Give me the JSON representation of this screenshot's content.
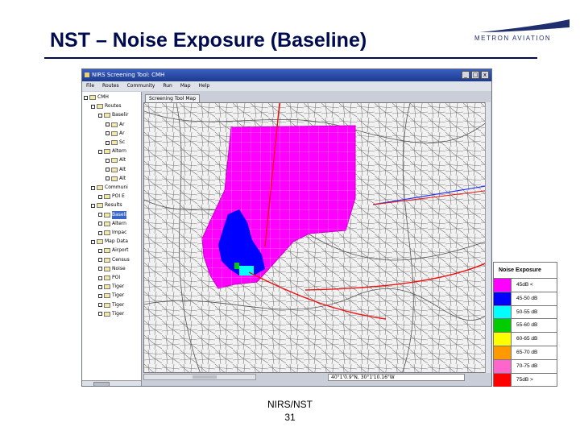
{
  "slide": {
    "title": "NST – Noise Exposure (Baseline)",
    "footer_line1": "NIRS/NST",
    "footer_line2": "31"
  },
  "logo": {
    "text": "METRON AVIATION",
    "icon": "metron-wing-logo"
  },
  "app": {
    "window_title": "NIRS Screening Tool: CMH",
    "menu": [
      "File",
      "Routes",
      "Community",
      "Run",
      "Map",
      "Help"
    ],
    "window_buttons": [
      "_",
      "□",
      "x"
    ],
    "tab_label": "Screening Tool Map",
    "coordinates": "40°1'0.9\"N, 30°1'10.16\"W"
  },
  "tree": {
    "items": [
      {
        "label": "CMH",
        "level": 0,
        "selected": false
      },
      {
        "label": "Routes",
        "level": 1,
        "selected": false
      },
      {
        "label": "Baselir",
        "level": 2,
        "selected": false
      },
      {
        "label": "Ar",
        "level": 3,
        "selected": false
      },
      {
        "label": "Ar",
        "level": 3,
        "selected": false
      },
      {
        "label": "Sc",
        "level": 3,
        "selected": false
      },
      {
        "label": "Altern",
        "level": 2,
        "selected": false
      },
      {
        "label": "Alt",
        "level": 3,
        "selected": false
      },
      {
        "label": "Alt",
        "level": 3,
        "selected": false
      },
      {
        "label": "Alt",
        "level": 3,
        "selected": false
      },
      {
        "label": "Communi",
        "level": 1,
        "selected": false
      },
      {
        "label": "POI E",
        "level": 2,
        "selected": false
      },
      {
        "label": "Results",
        "level": 1,
        "selected": false
      },
      {
        "label": "Baseli",
        "level": 2,
        "selected": true
      },
      {
        "label": "Altern",
        "level": 2,
        "selected": false
      },
      {
        "label": "Impac",
        "level": 2,
        "selected": false
      },
      {
        "label": "Map Data",
        "level": 1,
        "selected": false
      },
      {
        "label": "Airport",
        "level": 2,
        "selected": false
      },
      {
        "label": "Census",
        "level": 2,
        "selected": false
      },
      {
        "label": "Noise",
        "level": 2,
        "selected": false
      },
      {
        "label": "POI",
        "level": 2,
        "selected": false
      },
      {
        "label": "Tiger",
        "level": 2,
        "selected": false
      },
      {
        "label": "Tiger",
        "level": 2,
        "selected": false
      },
      {
        "label": "Tiger",
        "level": 2,
        "selected": false
      },
      {
        "label": "Tiger",
        "level": 2,
        "selected": false
      }
    ]
  },
  "legend": {
    "title": "Noise Exposure",
    "rows": [
      {
        "label": "45dB <",
        "color": "#ff00ff"
      },
      {
        "label": "45-50 dB",
        "color": "#0000ff"
      },
      {
        "label": "50-55 dB",
        "color": "#00ffff"
      },
      {
        "label": "55-60 dB",
        "color": "#00cc00"
      },
      {
        "label": "60-65 dB",
        "color": "#ffff00"
      },
      {
        "label": "65-70 dB",
        "color": "#ff9900"
      },
      {
        "label": "70-75 dB",
        "color": "#ff66cc"
      },
      {
        "label": "75dB >",
        "color": "#ff0000"
      }
    ]
  }
}
